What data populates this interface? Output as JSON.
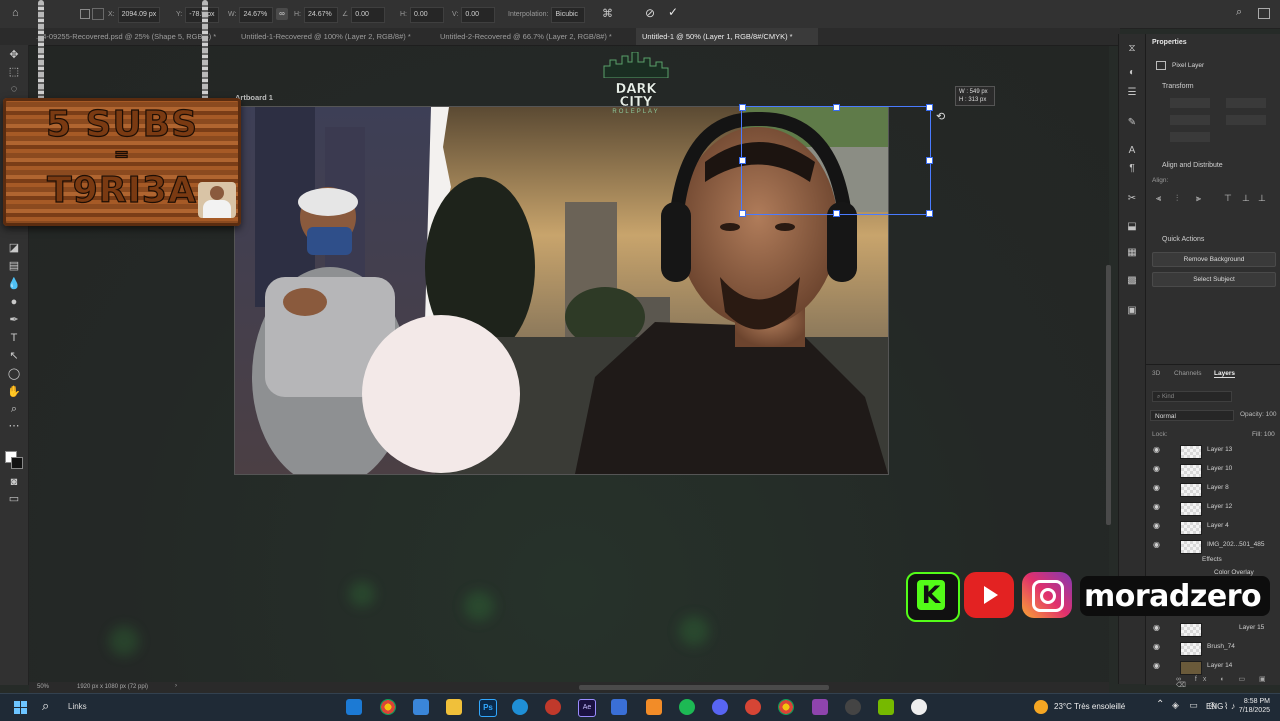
{
  "options_bar": {
    "x_label": "X:",
    "x_value": "2094.09 px",
    "y_label": "Y:",
    "y_value": "-78.5 px",
    "w_label": "W:",
    "w_value": "24.67%",
    "h_label": "H:",
    "h_value": "24.67%",
    "angle_value": "0.00",
    "h_skew_label": "H:",
    "h_skew_value": "0.00",
    "v_skew_label": "V:",
    "v_skew_value": "0.00",
    "interpolation_label": "Interpolation:",
    "interpolation_value": "Bicubic"
  },
  "tabs": [
    {
      "label": "...4-09255-Recovered.psd @ 25% (Shape 5, RGB/8) *"
    },
    {
      "label": "Untitled-1-Recovered @ 100% (Layer 2, RGB/8#) *"
    },
    {
      "label": "Untitled-2-Recovered @ 66.7% (Layer 2, RGB/8#) *"
    },
    {
      "label": "Untitled-1 @ 50% (Layer 1, RGB/8#/CMYK) *"
    }
  ],
  "artboard_label": "Artboard 1",
  "logo": {
    "line1": "DARK CITY",
    "line2": "ROLEPLAY"
  },
  "transform_readout": {
    "w": "W : 549 px",
    "h": "H : 313 px"
  },
  "sign": {
    "line1": "5 SUBS",
    "line2": "=",
    "line3": "T9RI3A"
  },
  "properties": {
    "title": "Properties",
    "layer_type": "Pixel Layer",
    "transform_section": "Transform",
    "align_section": "Align and Distribute",
    "align_label": "Align:",
    "quick_actions_section": "Quick Actions",
    "remove_bg_label": "Remove Background",
    "select_subject_label": "Select Subject"
  },
  "layers_panel": {
    "tabs": [
      "3D",
      "Channels",
      "Layers"
    ],
    "search_placeholder": "Kind",
    "blend_mode": "Normal",
    "opacity_label": "Opacity:",
    "opacity_value": "100",
    "lock_label": "Lock:",
    "fill_label": "Fill:",
    "fill_value": "100",
    "rows": [
      {
        "name": "Layer 13"
      },
      {
        "name": "Layer 10"
      },
      {
        "name": "Layer 8"
      },
      {
        "name": "Layer 12"
      },
      {
        "name": "Layer 4"
      },
      {
        "name": "IMG_202...501_485"
      },
      {
        "name": "Effects"
      },
      {
        "name": "Color Overlay"
      },
      {
        "name": "Layer 15"
      },
      {
        "name": "Brush_74"
      },
      {
        "name": "Layer 14"
      }
    ]
  },
  "status_bar": {
    "zoom": "50%",
    "doc_size": "1920 px x 1080 px (72 ppi)"
  },
  "social": {
    "handle": "moradzero",
    "kick_letter": "K"
  },
  "taskbar": {
    "search_label": "Links",
    "weather": "23°C  Très ensoleillé",
    "language": "ENG",
    "time": "8:58 PM",
    "date": "7/18/2025"
  }
}
